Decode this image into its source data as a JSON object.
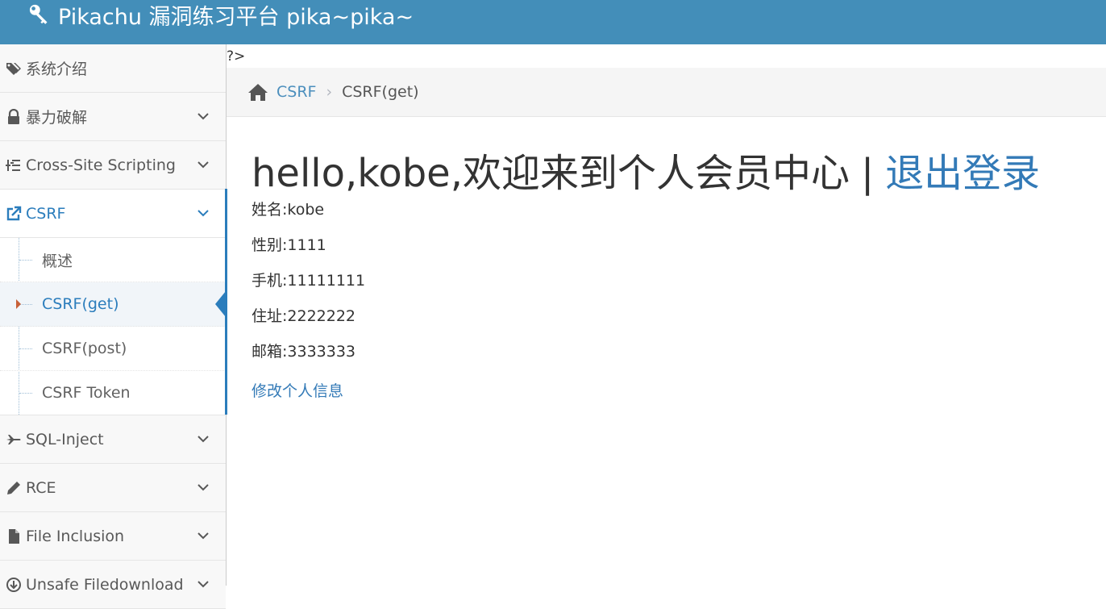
{
  "header": {
    "brand": "Pikachu 漏洞练习平台 pika~pika~"
  },
  "sidebar": {
    "items": [
      {
        "label": "系统介绍"
      },
      {
        "label": "暴力破解"
      },
      {
        "label": "Cross-Site Scripting"
      },
      {
        "label": "CSRF"
      },
      {
        "label": "SQL-Inject"
      },
      {
        "label": "RCE"
      },
      {
        "label": "File Inclusion"
      },
      {
        "label": "Unsafe Filedownload"
      }
    ],
    "csrf_sub": [
      {
        "label": "概述"
      },
      {
        "label": "CSRF(get)"
      },
      {
        "label": "CSRF(post)"
      },
      {
        "label": "CSRF Token"
      }
    ]
  },
  "main": {
    "php_leftover": "?>",
    "breadcrumb": {
      "section": "CSRF",
      "current": "CSRF(get)"
    },
    "greeting": "hello,kobe,欢迎来到个人会员中心",
    "separator": "|",
    "logout": "退出登录",
    "info": {
      "name": "姓名:kobe",
      "gender": "性别:1111",
      "phone": "手机:11111111",
      "address": "住址:2222222",
      "email": "邮箱:3333333"
    },
    "edit_link": "修改个人信息"
  },
  "colors": {
    "navbar": "#438eb9",
    "accent": "#2b7dbc",
    "link": "#337ab7"
  }
}
